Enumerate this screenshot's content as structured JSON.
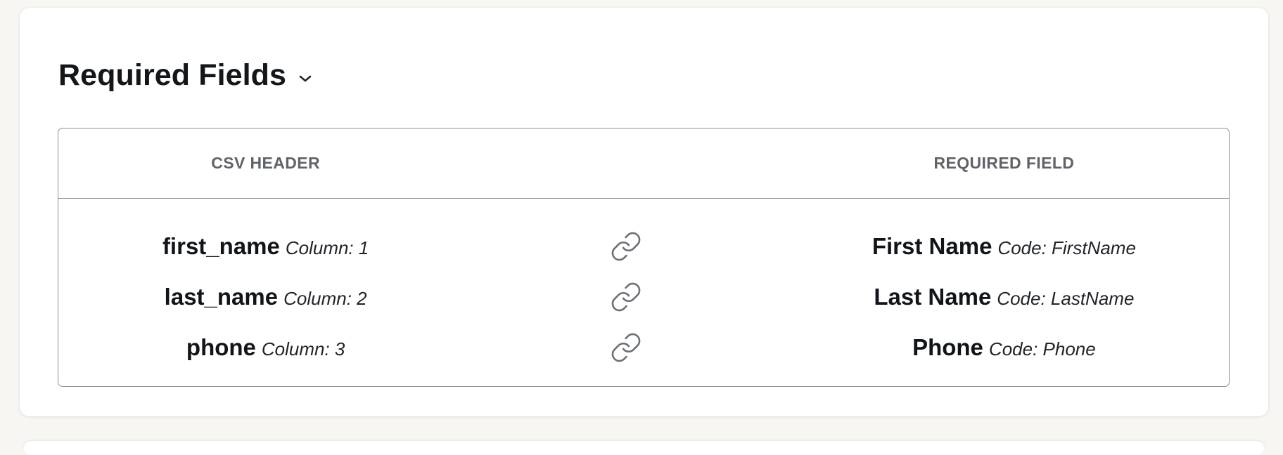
{
  "section": {
    "title": "Required Fields",
    "collapse_icon": "chevron-down-icon"
  },
  "table": {
    "headers": {
      "csv_header": "CSV HEADER",
      "required_field": "REQUIRED FIELD"
    },
    "rows": [
      {
        "csv_name": "first_name",
        "csv_column": "Column: 1",
        "link_icon": "link-icon",
        "field_name": "First Name",
        "field_code": "Code: FirstName"
      },
      {
        "csv_name": "last_name",
        "csv_column": "Column: 2",
        "link_icon": "link-icon",
        "field_name": "Last Name",
        "field_code": "Code: LastName"
      },
      {
        "csv_name": "phone",
        "csv_column": "Column: 3",
        "link_icon": "link-icon",
        "field_name": "Phone",
        "field_code": "Code: Phone"
      }
    ]
  },
  "colors": {
    "page_background": "#f7f6f3",
    "card_background": "#ffffff",
    "border": "#8c9196",
    "header_text": "#5f6368",
    "text": "#111418",
    "icon": "#6b7075"
  }
}
